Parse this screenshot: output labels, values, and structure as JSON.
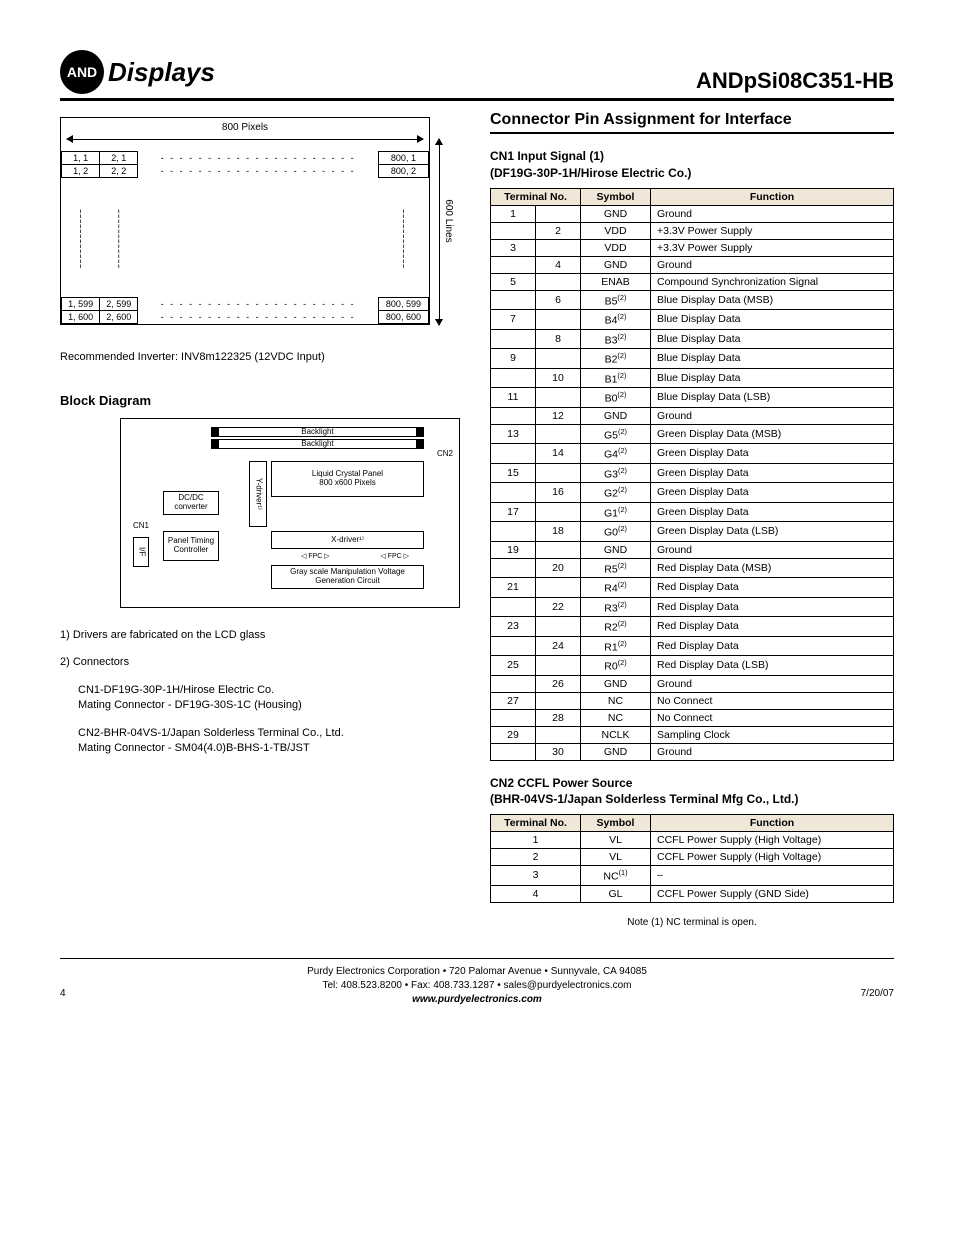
{
  "header": {
    "logo_badge": "AND",
    "logo_text": "Displays",
    "part_number": "ANDpSi08C351-HB"
  },
  "pixel_diagram": {
    "top_label": "800 Pixels",
    "side_label": "600 Lines",
    "cells": {
      "r1c1": "1, 1",
      "r1c2": "2, 1",
      "r1c3": "800, 1",
      "r2c1": "1, 2",
      "r2c2": "2, 2",
      "r2c3": "800, 2",
      "r3c1": "1, 599",
      "r3c2": "2, 599",
      "r3c3": "800, 599",
      "r4c1": "1, 600",
      "r4c2": "2, 600",
      "r4c3": "800, 600"
    }
  },
  "recommended": "Recommended Inverter:  INV8m122325 (12VDC Input)",
  "block_diagram_title": "Block Diagram",
  "block_diagram": {
    "backlight1": "Backlight",
    "backlight2": "Backlight",
    "lcp_line1": "Liquid Crystal Panel",
    "lcp_line2": "800 x600 Pixels",
    "ydriver": "Y-driver¹⁾",
    "dcdc": "DC/DC converter",
    "xdriver": "X-driver¹⁾",
    "panel": "Panel Timing Controller",
    "if": "I/F",
    "gray": "Gray scale Manipulation Voltage Generation Circuit",
    "cn1": "CN1",
    "cn2": "CN2",
    "fpc": "FPC"
  },
  "notes": {
    "n1": "1) Drivers are fabricated on the LCD glass",
    "n2a": "2) Connectors",
    "n2b": "CN1-DF19G-30P-1H/Hirose Electric Co.",
    "n2c": "Mating Connector - DF19G-30S-1C (Housing)",
    "n2d": "CN2-BHR-04VS-1/Japan Solderless Terminal Co., Ltd.",
    "n2e": "Mating Connector - SM04(4.0)B-BHS-1-TB/JST"
  },
  "right": {
    "title": "Connector Pin Assignment for Interface",
    "cn1_title1": "CN1 Input Signal (1)",
    "cn1_title2": "(DF19G-30P-1H/Hirose Electric Co.)",
    "cn2_title1": "CN2 CCFL Power Source",
    "cn2_title2": "(BHR-04VS-1/Japan Solderless Terminal Mfg Co., Ltd.)",
    "cn2_note": "Note (1) NC terminal is open."
  },
  "cn1_headers": {
    "h1": "Terminal No.",
    "h2": "Symbol",
    "h3": "Function"
  },
  "cn1_rows": [
    {
      "col": "a",
      "no": "1",
      "sym": "GND",
      "sup": "",
      "fn": "Ground"
    },
    {
      "col": "b",
      "no": "2",
      "sym": "VDD",
      "sup": "",
      "fn": "+3.3V Power Supply"
    },
    {
      "col": "a",
      "no": "3",
      "sym": "VDD",
      "sup": "",
      "fn": "+3.3V Power Supply"
    },
    {
      "col": "b",
      "no": "4",
      "sym": "GND",
      "sup": "",
      "fn": "Ground"
    },
    {
      "col": "a",
      "no": "5",
      "sym": "ENAB",
      "sup": "",
      "fn": "Compound Synchronization Signal"
    },
    {
      "col": "b",
      "no": "6",
      "sym": "B5",
      "sup": "(2)",
      "fn": "Blue Display Data (MSB)"
    },
    {
      "col": "a",
      "no": "7",
      "sym": "B4",
      "sup": "(2)",
      "fn": "Blue Display Data"
    },
    {
      "col": "b",
      "no": "8",
      "sym": "B3",
      "sup": "(2)",
      "fn": "Blue Display Data"
    },
    {
      "col": "a",
      "no": "9",
      "sym": "B2",
      "sup": "(2)",
      "fn": "Blue Display Data"
    },
    {
      "col": "b",
      "no": "10",
      "sym": "B1",
      "sup": "(2)",
      "fn": "Blue Display Data"
    },
    {
      "col": "a",
      "no": "11",
      "sym": "B0",
      "sup": "(2)",
      "fn": "Blue Display Data (LSB)"
    },
    {
      "col": "b",
      "no": "12",
      "sym": "GND",
      "sup": "",
      "fn": "Ground"
    },
    {
      "col": "a",
      "no": "13",
      "sym": "G5",
      "sup": "(2)",
      "fn": "Green Display Data (MSB)"
    },
    {
      "col": "b",
      "no": "14",
      "sym": "G4",
      "sup": "(2)",
      "fn": "Green Display Data"
    },
    {
      "col": "a",
      "no": "15",
      "sym": "G3",
      "sup": "(2)",
      "fn": "Green Display Data"
    },
    {
      "col": "b",
      "no": "16",
      "sym": "G2",
      "sup": "(2)",
      "fn": "Green Display Data"
    },
    {
      "col": "a",
      "no": "17",
      "sym": "G1",
      "sup": "(2)",
      "fn": "Green Display Data"
    },
    {
      "col": "b",
      "no": "18",
      "sym": "G0",
      "sup": "(2)",
      "fn": "Green Display Data (LSB)"
    },
    {
      "col": "a",
      "no": "19",
      "sym": "GND",
      "sup": "",
      "fn": "Ground"
    },
    {
      "col": "b",
      "no": "20",
      "sym": "R5",
      "sup": "(2)",
      "fn": "Red Display Data (MSB)"
    },
    {
      "col": "a",
      "no": "21",
      "sym": "R4",
      "sup": "(2)",
      "fn": "Red Display Data"
    },
    {
      "col": "b",
      "no": "22",
      "sym": "R3",
      "sup": "(2)",
      "fn": "Red Display Data"
    },
    {
      "col": "a",
      "no": "23",
      "sym": "R2",
      "sup": "(2)",
      "fn": "Red Display Data"
    },
    {
      "col": "b",
      "no": "24",
      "sym": "R1",
      "sup": "(2)",
      "fn": "Red Display Data"
    },
    {
      "col": "a",
      "no": "25",
      "sym": "R0",
      "sup": "(2)",
      "fn": "Red Display Data (LSB)"
    },
    {
      "col": "b",
      "no": "26",
      "sym": "GND",
      "sup": "",
      "fn": "Ground"
    },
    {
      "col": "a",
      "no": "27",
      "sym": "NC",
      "sup": "",
      "fn": "No Connect"
    },
    {
      "col": "b",
      "no": "28",
      "sym": "NC",
      "sup": "",
      "fn": "No Connect"
    },
    {
      "col": "a",
      "no": "29",
      "sym": "NCLK",
      "sup": "",
      "fn": "Sampling Clock"
    },
    {
      "col": "b",
      "no": "30",
      "sym": "GND",
      "sup": "",
      "fn": "Ground"
    }
  ],
  "cn2_headers": {
    "h1": "Terminal No.",
    "h2": "Symbol",
    "h3": "Function"
  },
  "cn2_rows": [
    {
      "no": "1",
      "sym": "VL",
      "sup": "",
      "fn": "CCFL Power Supply (High Voltage)"
    },
    {
      "no": "2",
      "sym": "VL",
      "sup": "",
      "fn": "CCFL Power Supply (High Voltage)"
    },
    {
      "no": "3",
      "sym": "NC",
      "sup": "(1)",
      "fn": "–"
    },
    {
      "no": "4",
      "sym": "GL",
      "sup": "",
      "fn": "CCFL Power Supply (GND Side)"
    }
  ],
  "footer": {
    "line1": "Purdy Electronics Corporation  •  720 Palomar Avenue  •  Sunnyvale, CA 94085",
    "line2": "Tel: 408.523.8200  •  Fax: 408.733.1287  •  sales@purdyelectronics.com",
    "web": "www.purdyelectronics.com",
    "page": "4",
    "date": "7/20/07"
  }
}
